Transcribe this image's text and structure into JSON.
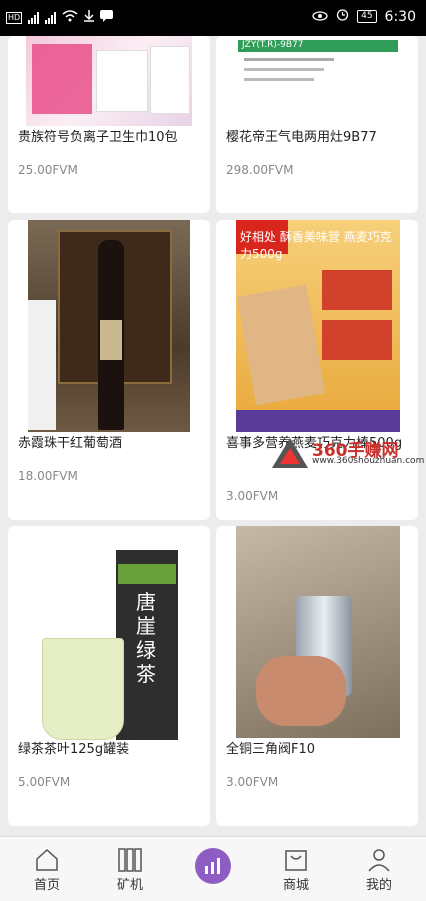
{
  "status_bar": {
    "left_icons": [
      "hd-badge",
      "signal-icon",
      "4g-signal-icon",
      "wifi-icon",
      "download-icon",
      "message-icon"
    ],
    "battery": "45",
    "time": "6:30"
  },
  "products": [
    {
      "name": "贵族符号负离子卫生巾10包",
      "price": "25.00FVM",
      "image_text": ""
    },
    {
      "name": "樱花帝王气电两用灶9B77",
      "price": "298.00FVM",
      "image_text": "JZY(T.R)-9B77"
    },
    {
      "name": "赤霞珠干红葡萄酒",
      "price": "18.00FVM",
      "image_text": ""
    },
    {
      "name": "喜事多营养燕麦巧克力棒500g",
      "price": "3.00FVM",
      "image_text": "好相处 酥香美味营 燕麦巧克力500g"
    },
    {
      "name": "绿茶茶叶125g罐装",
      "price": "5.00FVM",
      "image_text": "唐崖绿茶"
    },
    {
      "name": "全铜三角阀F10",
      "price": "3.00FVM",
      "image_text": ""
    }
  ],
  "watermark": {
    "brand": "360手赚网",
    "url": "www.360shouzhuan.com"
  },
  "nav": {
    "home": "首页",
    "miner": "矿机",
    "mall": "商城",
    "mine": "我的"
  },
  "colors": {
    "accent": "#8e5dc4",
    "price": "#888888"
  }
}
